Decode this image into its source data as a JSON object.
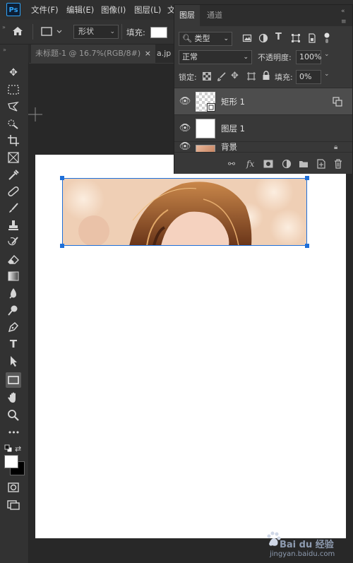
{
  "app": {
    "logo_text": "Ps"
  },
  "menu": [
    "文件(F)",
    "编辑(E)",
    "图像(I)",
    "图层(L)",
    "文"
  ],
  "options_bar": {
    "mode_value": "形状",
    "fill_label": "填充:"
  },
  "tabs": [
    {
      "label": "未标题-1 @ 16.7%(RGB/8#)",
      "close": "×"
    },
    {
      "label": "a.jp"
    }
  ],
  "layers_panel": {
    "tabs": [
      "图层",
      "通道"
    ],
    "filter_kind": "类型",
    "blend_mode": "正常",
    "opacity_label": "不透明度:",
    "opacity_value": "100%",
    "lock_label": "锁定:",
    "fill_label": "填充:",
    "fill_value": "0%",
    "layers": [
      {
        "name": "矩形 1",
        "selected": true
      },
      {
        "name": "图层 1",
        "selected": false
      },
      {
        "name": "背景",
        "selected": false
      }
    ],
    "footer_icons": [
      "link-icon",
      "fx-icon",
      "mask-icon",
      "adjustment-icon",
      "folder-icon",
      "new-layer-icon",
      "trash-icon"
    ]
  },
  "toolbar": {
    "more_label": "•••"
  },
  "watermark": {
    "text": "Bai du 经验",
    "url": "jingyan.baidu.com"
  },
  "colors": {
    "accent": "#1e6fd9",
    "panel_bg": "#383838",
    "selected_layer": "#4d4d4d"
  }
}
